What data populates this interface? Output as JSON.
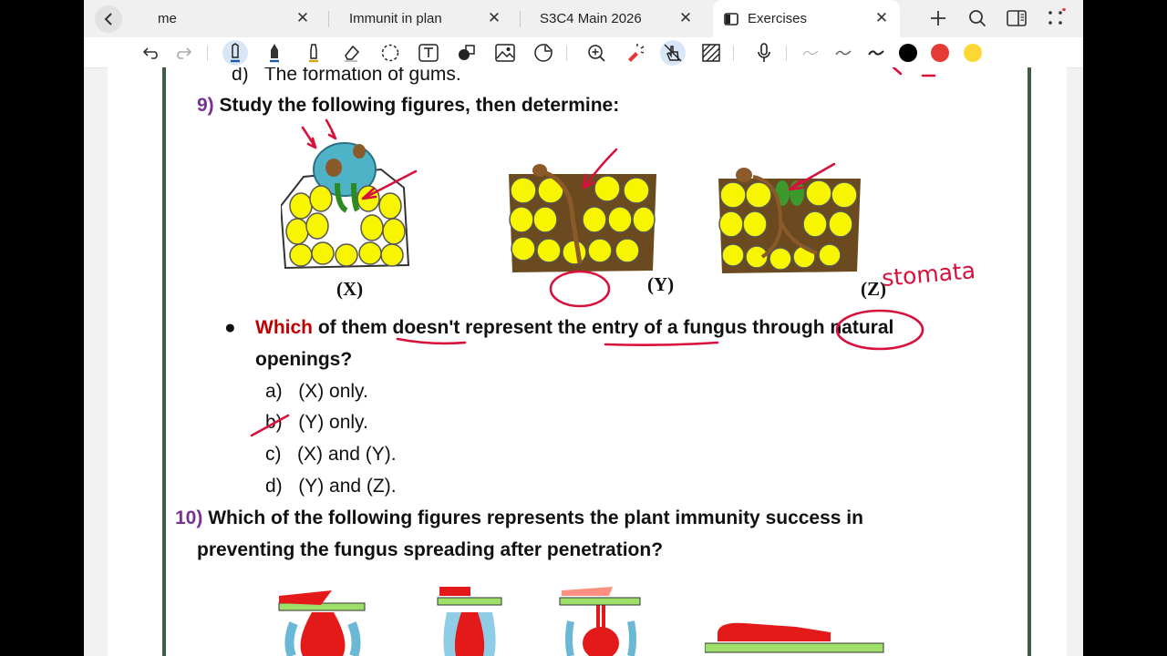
{
  "browser": {
    "tabs": [
      {
        "label": "me",
        "active": false
      },
      {
        "label": "Immunit in plan",
        "active": false
      },
      {
        "label": "S3C4 Main 2026",
        "active": false
      },
      {
        "label": "Exercises",
        "active": true
      }
    ]
  },
  "toolbar": {
    "tools": [
      "undo-icon",
      "redo-icon",
      "pen-icon",
      "fountain-pen-icon",
      "highlighter-icon",
      "eraser-icon",
      "lasso-icon",
      "text-box-icon",
      "shapes-icon",
      "image-icon",
      "sticker-icon",
      "zoom-icon",
      "laser-icon",
      "hand-touch-icon",
      "pattern-icon",
      "microphone-icon"
    ],
    "colors": [
      "#000000",
      "#e53935",
      "#fdd835"
    ]
  },
  "document": {
    "prev_option": {
      "letter": "d)",
      "text": "The formation of gums."
    },
    "q9": {
      "number": "9)",
      "prompt": "Study the following figures, then determine:",
      "figure_labels": [
        "(X)",
        "(Y)",
        "(Z)"
      ],
      "question_word1": "Which",
      "question_rest_line1": "of them doesn't represent the entry of a fungus through natural",
      "question_line2": "openings?",
      "options": [
        {
          "letter": "a)",
          "text": "(X) only."
        },
        {
          "letter": "b)",
          "text": "(Y) only."
        },
        {
          "letter": "c)",
          "text": "(X) and (Y)."
        },
        {
          "letter": "d)",
          "text": "(Y) and (Z)."
        }
      ]
    },
    "q10": {
      "number": "10)",
      "prompt_line1": "Which of the following figures represents the plant immunity success in",
      "prompt_line2": "preventing the fungus spreading after penetration?"
    },
    "annotations": {
      "handwritten": "stomata"
    }
  }
}
